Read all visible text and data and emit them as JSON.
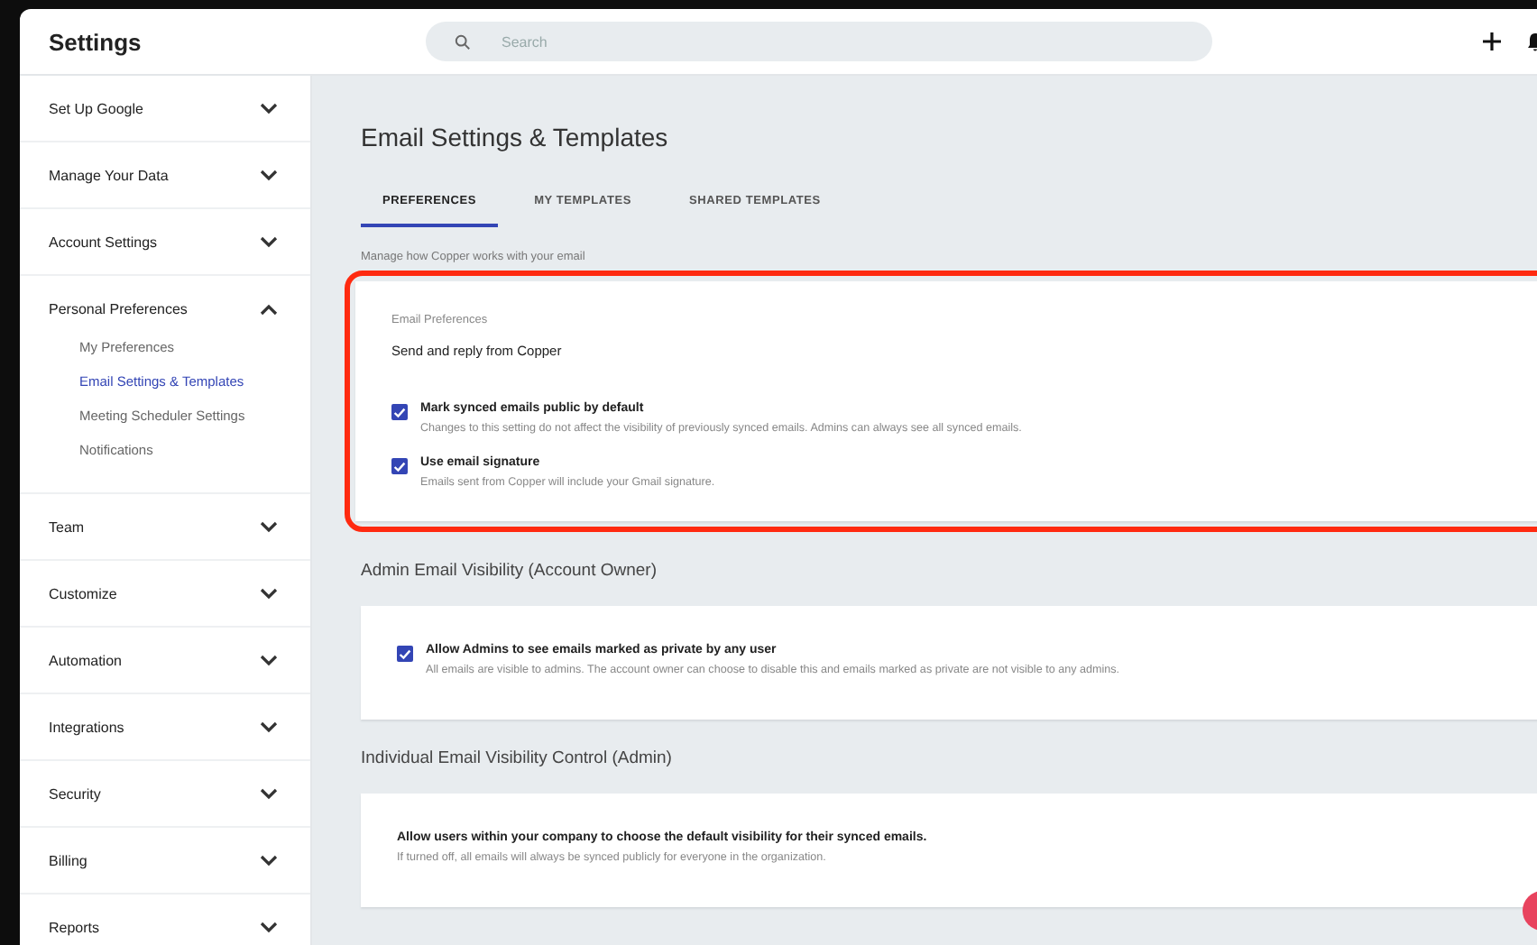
{
  "window": {
    "title": "Settings"
  },
  "search": {
    "placeholder": "Search"
  },
  "sidebar": {
    "items": [
      {
        "label": "Set Up Google",
        "expanded": false
      },
      {
        "label": "Manage Your Data",
        "expanded": false
      },
      {
        "label": "Account Settings",
        "expanded": false
      },
      {
        "label": "Personal Preferences",
        "expanded": true,
        "children": [
          {
            "label": "My Preferences",
            "selected": false
          },
          {
            "label": "Email Settings & Templates",
            "selected": true
          },
          {
            "label": "Meeting Scheduler Settings",
            "selected": false
          },
          {
            "label": "Notifications",
            "selected": false
          }
        ]
      },
      {
        "label": "Team",
        "expanded": false
      },
      {
        "label": "Customize",
        "expanded": false
      },
      {
        "label": "Automation",
        "expanded": false
      },
      {
        "label": "Integrations",
        "expanded": false
      },
      {
        "label": "Security",
        "expanded": false
      },
      {
        "label": "Billing",
        "expanded": false
      },
      {
        "label": "Reports",
        "expanded": false
      }
    ]
  },
  "page": {
    "title": "Email Settings & Templates",
    "tabs": [
      {
        "label": "PREFERENCES",
        "selected": true
      },
      {
        "label": "MY TEMPLATES",
        "selected": false
      },
      {
        "label": "SHARED TEMPLATES",
        "selected": false
      }
    ],
    "subtitle": "Manage how Copper works with your email",
    "sections": [
      {
        "highlighted": true,
        "card_label": "Email Preferences",
        "line": "Send and reply from Copper",
        "options": [
          {
            "label": "Mark synced emails public by default",
            "description": "Changes to this setting do not affect the visibility of previously synced emails. Admins can always see all synced emails.",
            "checked": true
          },
          {
            "label": "Use email signature",
            "description": "Emails sent from Copper will include your Gmail signature.",
            "checked": true
          }
        ]
      },
      {
        "heading": "Admin Email Visibility (Account Owner)",
        "highlighted": false,
        "options": [
          {
            "label": "Allow Admins to see emails marked as private by any user",
            "description": "All emails are visible to admins. The account owner can choose to disable this and emails marked as private are not visible to any admins.",
            "checked": true
          }
        ]
      },
      {
        "heading": "Individual Email Visibility Control (Admin)",
        "highlighted": false,
        "statement": "Allow users within your company to choose the default visibility for their synced emails.",
        "statement_note": "If turned off, all emails will always be synced publicly for everyone in the organization."
      }
    ]
  }
}
